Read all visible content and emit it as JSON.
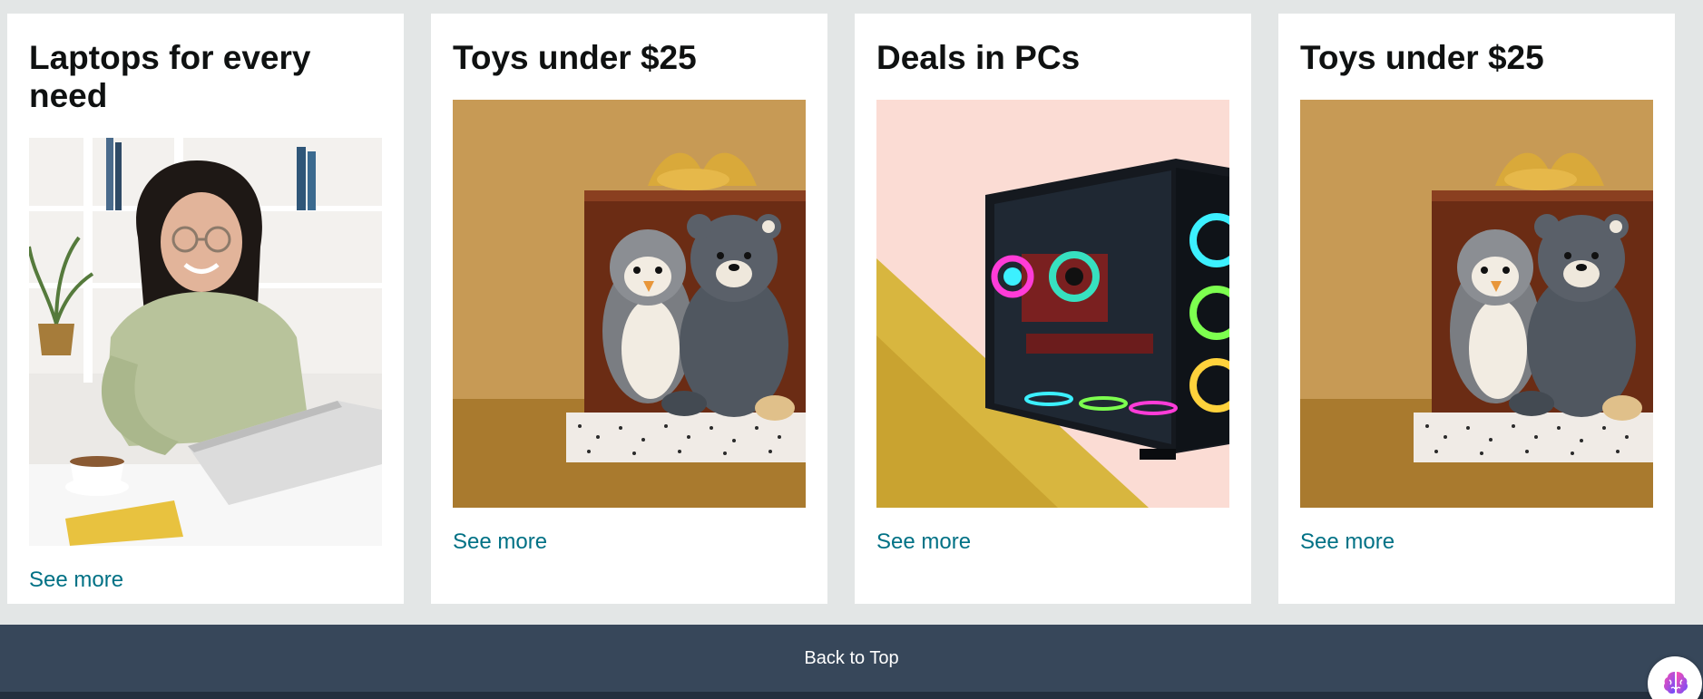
{
  "cards": [
    {
      "title": "Laptops for every need",
      "link_label": "See more",
      "image_alt": "Woman smiling while using a laptop"
    },
    {
      "title": "Toys under $25",
      "link_label": "See more",
      "image_alt": "Plush penguin and bear in a gift box"
    },
    {
      "title": "Deals in PCs",
      "link_label": "See more",
      "image_alt": "Gaming PC tower with RGB fans"
    },
    {
      "title": "Toys under $25",
      "link_label": "See more",
      "image_alt": "Plush penguin and bear in a gift box"
    }
  ],
  "footer": {
    "back_to_top_label": "Back to Top"
  },
  "assistant": {
    "icon": "brain-icon"
  },
  "colors": {
    "page_background": "#e3e6e6",
    "card_background": "#ffffff",
    "link": "#007185",
    "back_to_top_bar": "#37475a",
    "footer_bar": "#232f3e"
  }
}
